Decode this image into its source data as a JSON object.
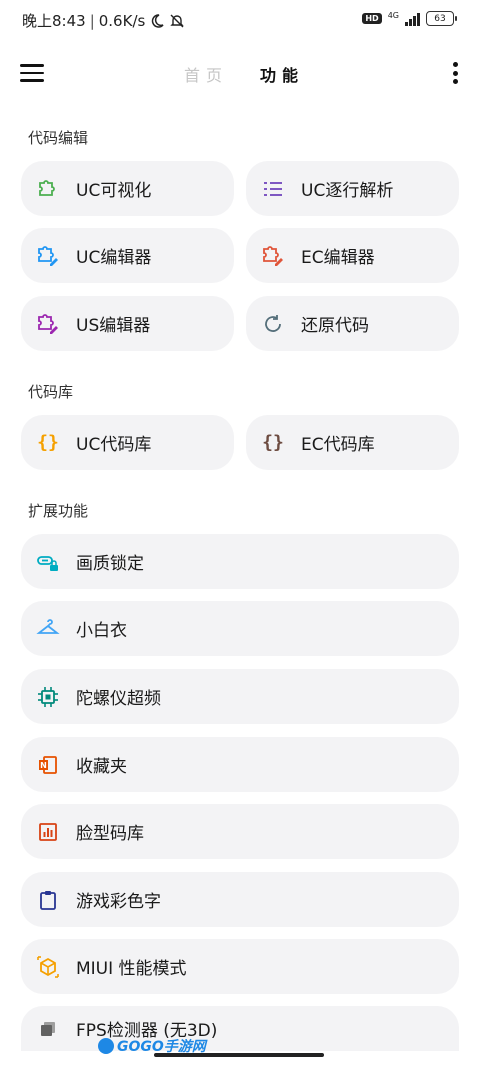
{
  "status_bar": {
    "time": "晚上8:43",
    "speed": "0.6K/s",
    "hd": "HD",
    "network": "4G",
    "battery": "63"
  },
  "header": {
    "tab_home": "首页",
    "tab_features": "功能"
  },
  "sections": {
    "code_edit": {
      "title": "代码编辑",
      "items": [
        {
          "label": "UC可视化",
          "icon": "puzzle-icon",
          "color": "#4caf50"
        },
        {
          "label": "UC逐行解析",
          "icon": "list-icon",
          "color": "#7e57c2"
        },
        {
          "label": "UC编辑器",
          "icon": "puzzle-edit-icon",
          "color": "#2196f3"
        },
        {
          "label": "EC编辑器",
          "icon": "puzzle-edit-icon",
          "color": "#e0553a"
        },
        {
          "label": "US编辑器",
          "icon": "puzzle-edit-icon",
          "color": "#9c27b0"
        },
        {
          "label": "还原代码",
          "icon": "refresh-icon",
          "color": "#546e7a"
        }
      ]
    },
    "code_lib": {
      "title": "代码库",
      "items": [
        {
          "label": "UC代码库",
          "icon": "braces-icon",
          "color": "#f5a000"
        },
        {
          "label": "EC代码库",
          "icon": "braces-icon",
          "color": "#6d4c41"
        }
      ]
    },
    "extensions": {
      "title": "扩展功能",
      "items": [
        {
          "label": "画质锁定",
          "icon": "link-lock-icon",
          "color": "#00acc1"
        },
        {
          "label": "小白衣",
          "icon": "hanger-icon",
          "color": "#42a5f5"
        },
        {
          "label": "陀螺仪超频",
          "icon": "chip-icon",
          "color": "#00897b"
        },
        {
          "label": "收藏夹",
          "icon": "notebook-icon",
          "color": "#e65100"
        },
        {
          "label": "脸型码库",
          "icon": "bar-chart-icon",
          "color": "#d84315"
        },
        {
          "label": "游戏彩色字",
          "icon": "clipboard-icon",
          "color": "#283593"
        },
        {
          "label": "MIUI 性能模式",
          "icon": "cube-icon",
          "color": "#f5a000"
        },
        {
          "label": "FPS检测器 (无3D)",
          "icon": "layers-icon",
          "color": "#616161"
        }
      ]
    }
  },
  "watermark": "GOGO手游网"
}
